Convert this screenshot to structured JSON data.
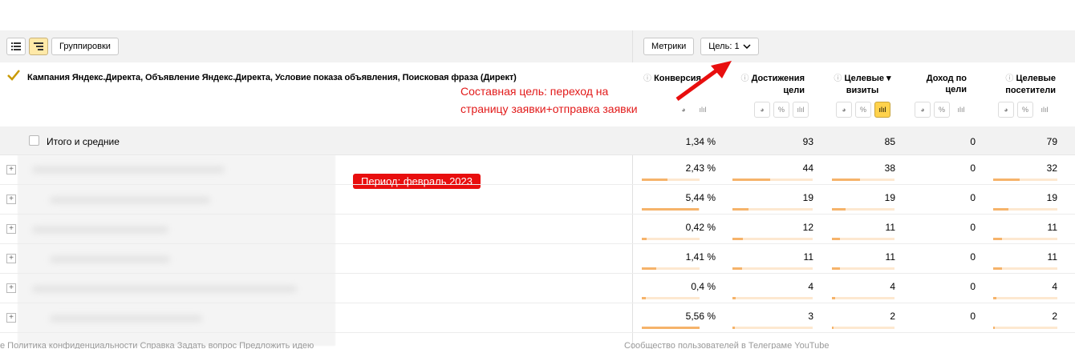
{
  "toolbar": {
    "groupings_label": "Группировки",
    "metrics_label": "Метрики",
    "goal_label": "Цель: 1"
  },
  "header": {
    "group_title": "Кампания Яндекс.Директа, Объявление Яндекс.Директа, Условие показа объявления, Поисковая фраза (Директ)",
    "columns": [
      {
        "line1": "Конверсия",
        "line2": "",
        "info": true
      },
      {
        "line1": "Достижения",
        "line2": "цели",
        "info": true
      },
      {
        "line1": "Целевые ▾",
        "line2": "визиты",
        "info": true
      },
      {
        "line1": "Доход по",
        "line2": "цели",
        "info": false
      },
      {
        "line1": "Целевые",
        "line2": "посетители",
        "info": true
      }
    ]
  },
  "annotations": {
    "goal_note_line1": "Составная цель: переход на",
    "goal_note_line2": "страницу заявки+отправка заявки",
    "period": "Период: февраль 2023"
  },
  "totals": {
    "label": "Итого и средние",
    "values": [
      "1,34 %",
      "93",
      "85",
      "0",
      "79"
    ]
  },
  "rows": [
    {
      "values": [
        "2,43 %",
        "44",
        "38",
        "0",
        "32"
      ],
      "fills": [
        0.44,
        0.47,
        0.45,
        0,
        0.41
      ]
    },
    {
      "values": [
        "5,44 %",
        "19",
        "19",
        "0",
        "19"
      ],
      "fills": [
        0.98,
        0.2,
        0.22,
        0,
        0.24
      ]
    },
    {
      "values": [
        "0,42 %",
        "12",
        "11",
        "0",
        "11"
      ],
      "fills": [
        0.08,
        0.13,
        0.13,
        0,
        0.14
      ]
    },
    {
      "values": [
        "1,41 %",
        "11",
        "11",
        "0",
        "11"
      ],
      "fills": [
        0.25,
        0.12,
        0.13,
        0,
        0.14
      ]
    },
    {
      "values": [
        "0,4 %",
        "4",
        "4",
        "0",
        "4"
      ],
      "fills": [
        0.07,
        0.04,
        0.05,
        0,
        0.05
      ]
    },
    {
      "values": [
        "5,56 %",
        "3",
        "2",
        "0",
        "2"
      ],
      "fills": [
        1.0,
        0.03,
        0.02,
        0,
        0.03
      ]
    }
  ],
  "footer": {
    "left": "е   Политика конфиденциальности   Справка   Задать вопрос   Предложить идею",
    "right": "Сообщество пользователей в Телеграме   YouTube"
  },
  "colors": {
    "accent_yellow": "#ffd24c",
    "bar": "#f6b36a",
    "annotation_red": "#e21a1a"
  }
}
